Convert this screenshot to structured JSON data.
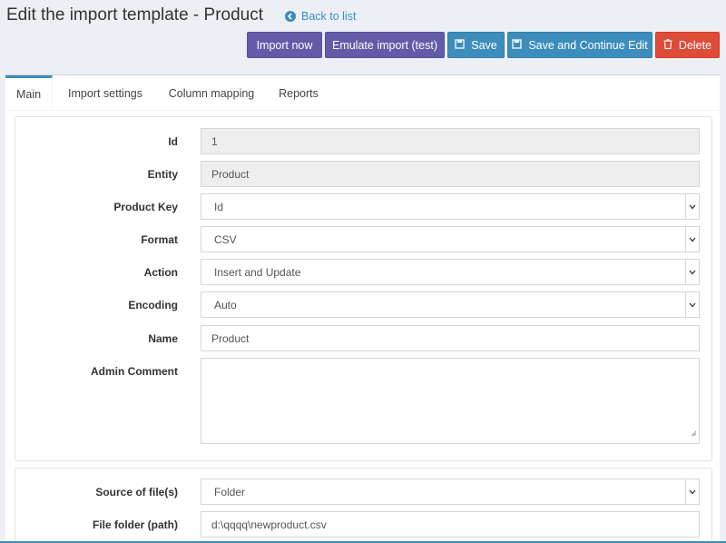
{
  "header": {
    "title": "Edit the import template - Product",
    "back_label": "Back to list"
  },
  "toolbar": {
    "import_now": "Import now",
    "emulate": "Emulate import (test)",
    "save": "Save",
    "save_continue": "Save and Continue Edit",
    "delete": "Delete"
  },
  "tabs": [
    {
      "label": "Main"
    },
    {
      "label": "Import settings"
    },
    {
      "label": "Column mapping"
    },
    {
      "label": "Reports"
    }
  ],
  "form": {
    "id": {
      "label": "Id",
      "value": "1"
    },
    "entity": {
      "label": "Entity",
      "value": "Product"
    },
    "product_key": {
      "label": "Product Key",
      "value": "Id"
    },
    "format": {
      "label": "Format",
      "value": "CSV"
    },
    "action": {
      "label": "Action",
      "value": "Insert and Update"
    },
    "encoding": {
      "label": "Encoding",
      "value": "Auto"
    },
    "name": {
      "label": "Name",
      "value": "Product"
    },
    "admin_comment": {
      "label": "Admin Comment",
      "value": ""
    }
  },
  "source": {
    "source_files": {
      "label": "Source of file(s)",
      "value": "Folder"
    },
    "file_folder": {
      "label": "File folder (path)",
      "value": "d:\\qqqq\\newproduct.csv"
    }
  },
  "colors": {
    "purple": "#605ca8",
    "blue": "#3c8dbc",
    "red": "#dd4b39",
    "background": "#ecf0f5"
  }
}
